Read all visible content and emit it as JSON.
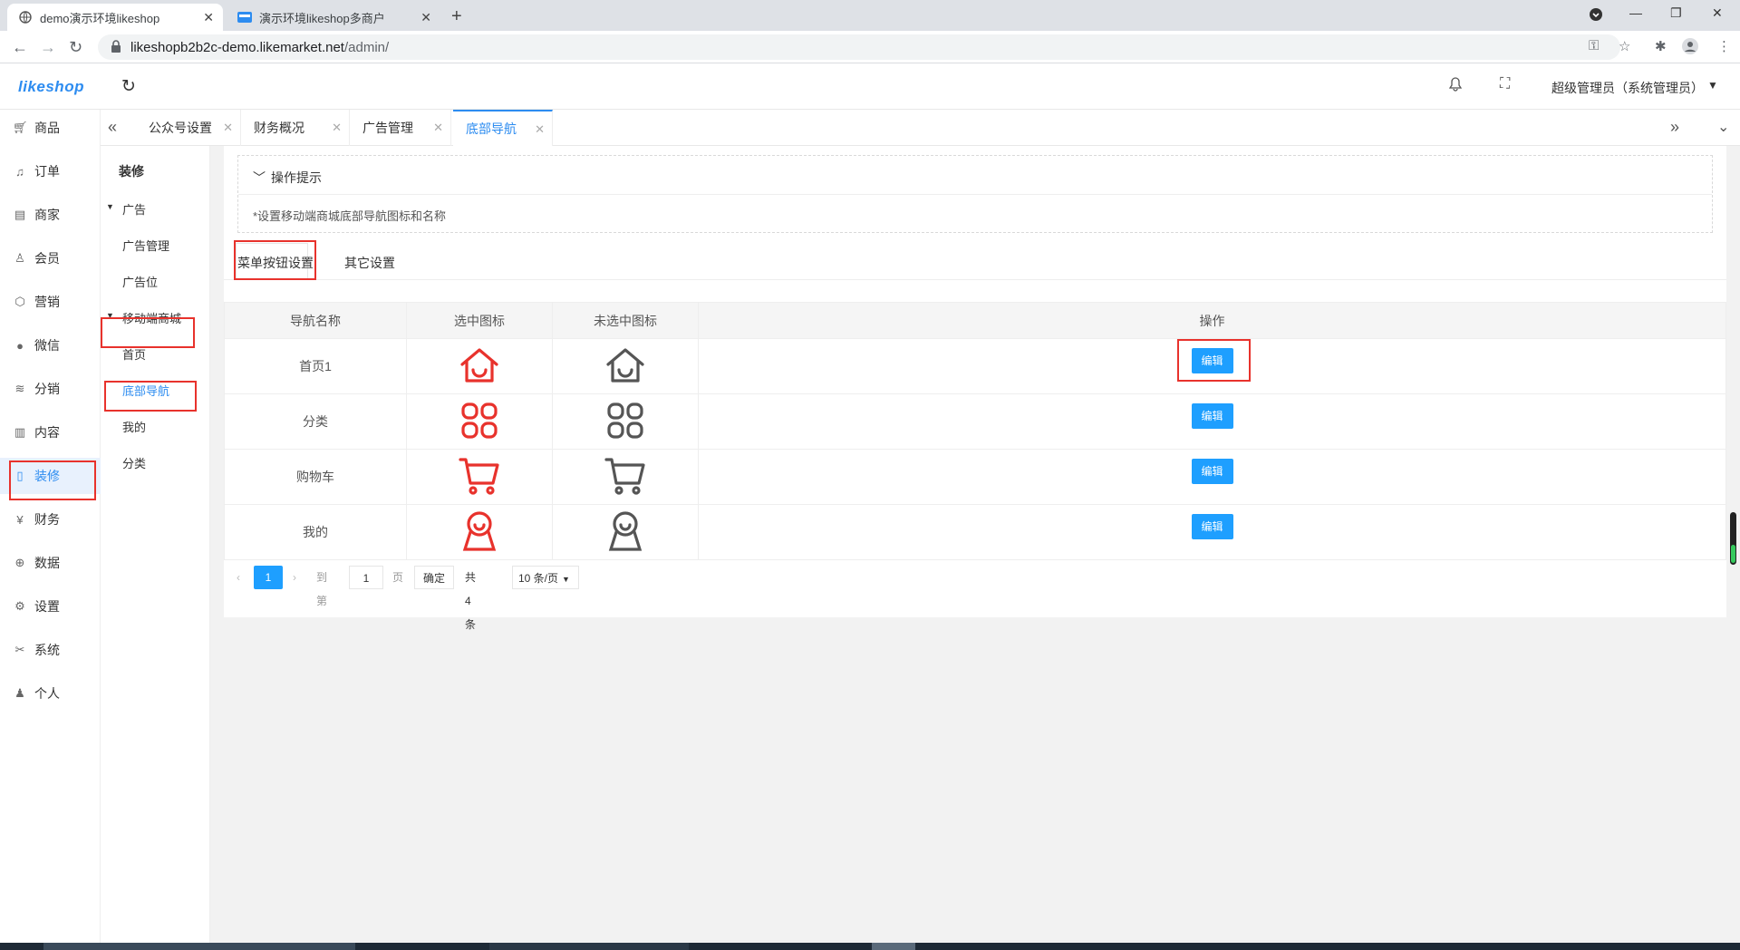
{
  "browser": {
    "tabs": [
      {
        "title": "demo演示环境likeshop",
        "active": true
      },
      {
        "title": "演示环境likeshop多商户",
        "active": false
      }
    ],
    "url_host": "likeshopb2b2c-demo.likemarket.net",
    "url_path": "/admin/"
  },
  "header": {
    "logo": "likeshop",
    "admin": "超级管理员（系统管理员）"
  },
  "sidebar": {
    "items": [
      {
        "label": "商品",
        "icon": "cart-icon"
      },
      {
        "label": "订单",
        "icon": "bell-icon"
      },
      {
        "label": "商家",
        "icon": "store-icon"
      },
      {
        "label": "会员",
        "icon": "user-icon"
      },
      {
        "label": "营销",
        "icon": "cube-icon"
      },
      {
        "label": "微信",
        "icon": "wechat-icon"
      },
      {
        "label": "分销",
        "icon": "layers-icon"
      },
      {
        "label": "内容",
        "icon": "book-icon"
      },
      {
        "label": "装修",
        "icon": "tablet-icon",
        "active": true
      },
      {
        "label": "财务",
        "icon": "yen-icon"
      },
      {
        "label": "数据",
        "icon": "globe-icon"
      },
      {
        "label": "设置",
        "icon": "gear-icon"
      },
      {
        "label": "系统",
        "icon": "tools-icon"
      },
      {
        "label": "个人",
        "icon": "person-icon"
      }
    ]
  },
  "submenu": {
    "title": "装修",
    "group1": "广告",
    "ad_manage": "广告管理",
    "ad_slot": "广告位",
    "group2": "移动端商城",
    "home": "首页",
    "bottom_nav": "底部导航",
    "mine": "我的",
    "category": "分类"
  },
  "pagetabs": [
    "公众号设置",
    "财务概况",
    "广告管理",
    "底部导航"
  ],
  "tips": {
    "title": "操作提示",
    "body": "*设置移动端商城底部导航图标和名称"
  },
  "subtabs": [
    "菜单按钮设置",
    "其它设置"
  ],
  "table": {
    "headers": [
      "导航名称",
      "选中图标",
      "未选中图标",
      "操作"
    ],
    "rows": [
      {
        "name": "首页1",
        "icon": "home-icon",
        "action": "编辑"
      },
      {
        "name": "分类",
        "icon": "grid-icon",
        "action": "编辑"
      },
      {
        "name": "购物车",
        "icon": "cart-icon",
        "action": "编辑"
      },
      {
        "name": "我的",
        "icon": "user-icon",
        "action": "编辑"
      }
    ]
  },
  "pager": {
    "current": "1",
    "goto_label": "到第",
    "goto_value": "1",
    "page_unit": "页",
    "confirm": "确定",
    "total": "共 4 条",
    "page_size": "10 条/页"
  },
  "colors": {
    "accent": "#2d8cf0",
    "button": "#1e9fff",
    "active_icon": "#e8322c",
    "inactive_icon": "#555555",
    "highlight": "#e8322c"
  }
}
